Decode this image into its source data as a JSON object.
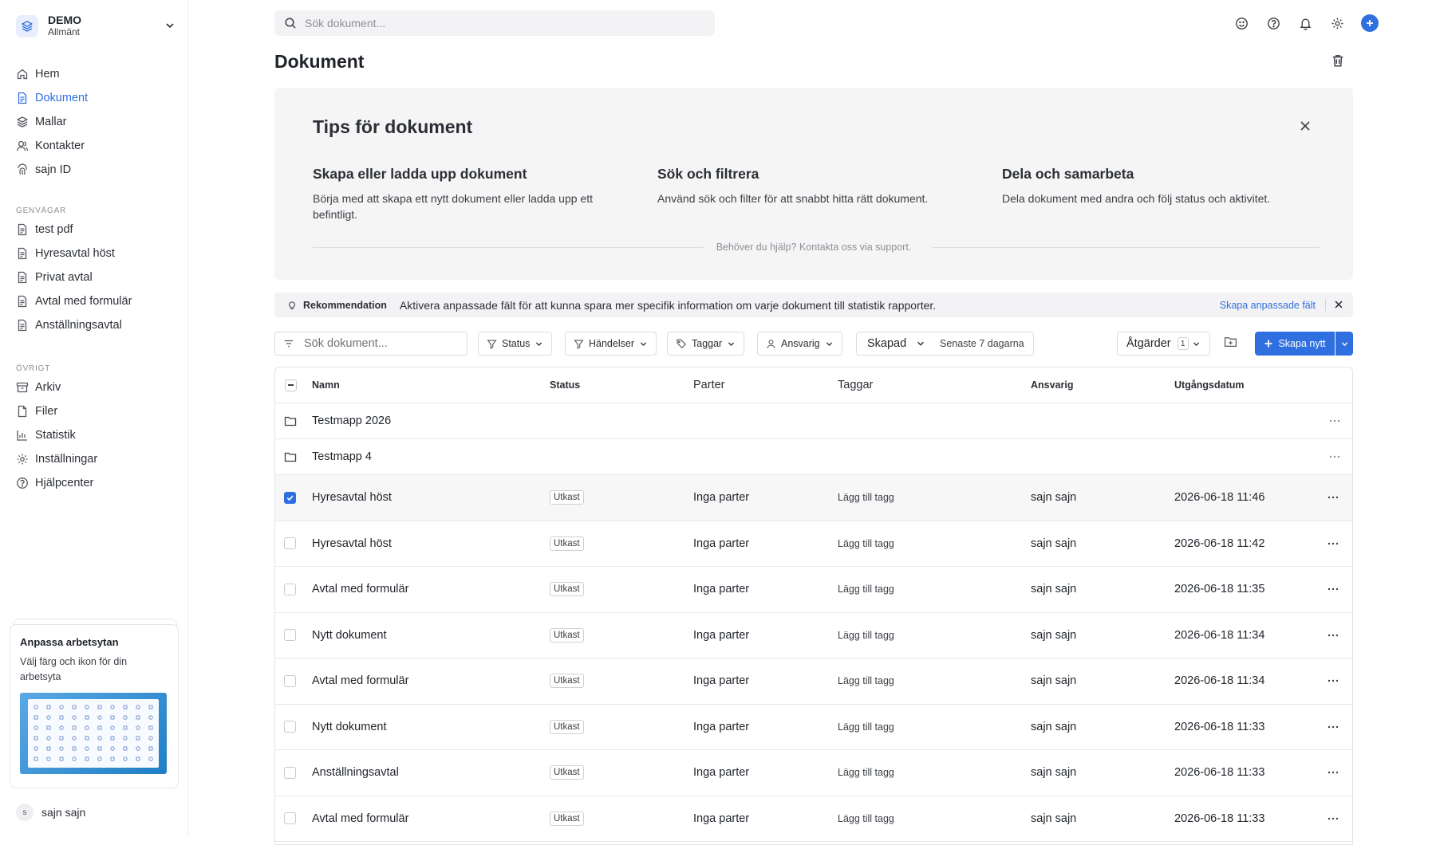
{
  "workspace": {
    "name": "DEMO",
    "subtitle": "Allmänt"
  },
  "sidebar": {
    "main": [
      {
        "label": "Hem",
        "icon": "home-icon"
      },
      {
        "label": "Dokument",
        "icon": "document-icon",
        "active": true
      },
      {
        "label": "Mallar",
        "icon": "layers-icon"
      },
      {
        "label": "Kontakter",
        "icon": "contacts-icon"
      },
      {
        "label": "sajn ID",
        "icon": "fingerprint-icon"
      }
    ],
    "shortcuts_title": "GENVÄGAR",
    "shortcuts": [
      {
        "label": "test pdf"
      },
      {
        "label": "Hyresavtal höst"
      },
      {
        "label": "Privat avtal"
      },
      {
        "label": "Avtal med formulär"
      },
      {
        "label": "Anställningsavtal"
      }
    ],
    "other_title": "ÖVRIGT",
    "other": [
      {
        "label": "Arkiv",
        "icon": "archive-icon"
      },
      {
        "label": "Filer",
        "icon": "file-icon"
      },
      {
        "label": "Statistik",
        "icon": "bar-chart-icon"
      },
      {
        "label": "Inställningar",
        "icon": "gear-icon"
      },
      {
        "label": "Hjälpcenter",
        "icon": "help-icon"
      }
    ]
  },
  "promo": {
    "title": "Anpassa arbetsytan",
    "text": "Välj färg och ikon för din arbetsyta"
  },
  "user": {
    "initial": "s",
    "name": "sajn sajn"
  },
  "topbar": {
    "search_placeholder": "Sök dokument..."
  },
  "page": {
    "title": "Dokument"
  },
  "tips": {
    "title": "Tips för dokument",
    "items": [
      {
        "title": "Skapa eller ladda upp dokument",
        "text": "Börja med att skapa ett nytt dokument eller ladda upp ett befintligt."
      },
      {
        "title": "Sök och filtrera",
        "text": "Använd sök och filter för att snabbt hitta rätt dokument."
      },
      {
        "title": "Dela och samarbeta",
        "text": "Dela dokument med andra och följ status och aktivitet."
      }
    ],
    "help": "Behöver du hjälp? Kontakta oss via support."
  },
  "recommendation": {
    "label": "Rekommendation",
    "text": "Aktivera anpassade fält för att kunna spara mer specifik information om varje dokument till statistik rapporter.",
    "link": "Skapa anpassade fält"
  },
  "filters": {
    "search_placeholder": "Sök dokument...",
    "status": "Status",
    "events": "Händelser",
    "tags": "Taggar",
    "owner": "Ansvarig",
    "created": "Skapad",
    "created_range": "Senaste 7 dagarna",
    "actions": "Åtgärder",
    "actions_count": "1",
    "create_new": "Skapa nytt"
  },
  "table": {
    "headers": {
      "name": "Namn",
      "status": "Status",
      "parties": "Parter",
      "tags": "Taggar",
      "owner": "Ansvarig",
      "expiry": "Utgångsdatum"
    },
    "folders": [
      {
        "name": "Testmapp 2026"
      },
      {
        "name": "Testmapp 4"
      }
    ],
    "rows": [
      {
        "name": "Hyresavtal höst",
        "status": "Utkast",
        "parties": "Inga parter",
        "tags": "Lägg till tagg",
        "owner": "sajn sajn",
        "date": "2026-06-18 11:46",
        "checked": true
      },
      {
        "name": "Hyresavtal höst",
        "status": "Utkast",
        "parties": "Inga parter",
        "tags": "Lägg till tagg",
        "owner": "sajn sajn",
        "date": "2026-06-18 11:42",
        "checked": false
      },
      {
        "name": "Avtal med formulär",
        "status": "Utkast",
        "parties": "Inga parter",
        "tags": "Lägg till tagg",
        "owner": "sajn sajn",
        "date": "2026-06-18 11:35",
        "checked": false
      },
      {
        "name": "Nytt dokument",
        "status": "Utkast",
        "parties": "Inga parter",
        "tags": "Lägg till tagg",
        "owner": "sajn sajn",
        "date": "2026-06-18 11:34",
        "checked": false
      },
      {
        "name": "Avtal med formulär",
        "status": "Utkast",
        "parties": "Inga parter",
        "tags": "Lägg till tagg",
        "owner": "sajn sajn",
        "date": "2026-06-18 11:34",
        "checked": false
      },
      {
        "name": "Nytt dokument",
        "status": "Utkast",
        "parties": "Inga parter",
        "tags": "Lägg till tagg",
        "owner": "sajn sajn",
        "date": "2026-06-18 11:33",
        "checked": false
      },
      {
        "name": "Anställningsavtal",
        "status": "Utkast",
        "parties": "Inga parter",
        "tags": "Lägg till tagg",
        "owner": "sajn sajn",
        "date": "2026-06-18 11:33",
        "checked": false
      },
      {
        "name": "Avtal med formulär",
        "status": "Utkast",
        "parties": "Inga parter",
        "tags": "Lägg till tagg",
        "owner": "sajn sajn",
        "date": "2026-06-18 11:33",
        "checked": false
      }
    ]
  },
  "colors": {
    "accent": "#2f6fe0",
    "panel": "#f5f5f6",
    "border": "#e2e3e7"
  }
}
